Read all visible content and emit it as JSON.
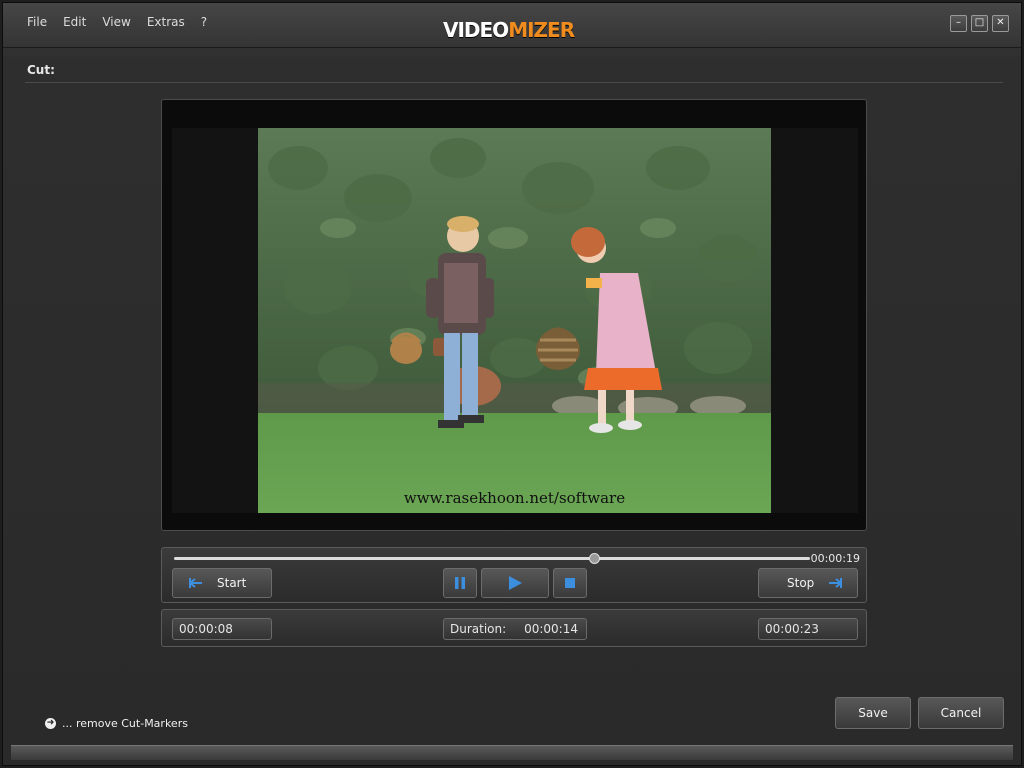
{
  "menu": [
    "File",
    "Edit",
    "View",
    "Extras",
    "?"
  ],
  "app": {
    "logo_part1": "VIDEO",
    "logo_part2": "MIZER"
  },
  "window_controls": {
    "minimize": "–",
    "maximize": "□",
    "close": "✕"
  },
  "section": {
    "title": "Cut:"
  },
  "video": {
    "watermark": "www.rasekhoon.net/software"
  },
  "playback": {
    "position_time": "00:00:19",
    "position_fraction": 0.66
  },
  "transport": {
    "start_label": "Start",
    "stop_label": "Stop"
  },
  "times": {
    "start": "00:00:08",
    "duration_label": "Duration:",
    "duration": "00:00:14",
    "stop": "00:00:23"
  },
  "actions": {
    "remove_markers": "... remove Cut-Markers",
    "save": "Save",
    "cancel": "Cancel"
  },
  "colors": {
    "accent": "#f08c1e",
    "icon_blue": "#3c8ede"
  }
}
